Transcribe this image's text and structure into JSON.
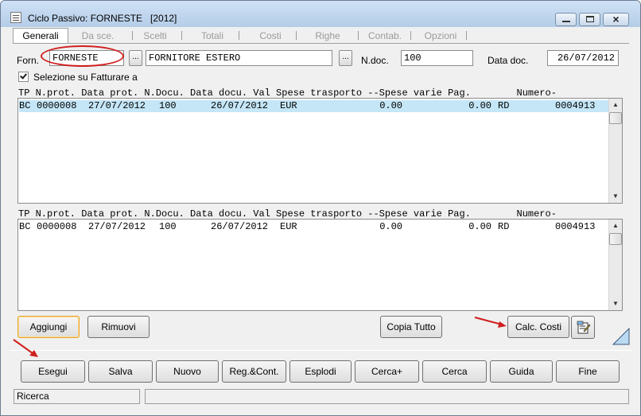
{
  "window": {
    "title": "Ciclo Passivo: FORNESTE   [2012]",
    "controls": {
      "minimize": "minimize",
      "maximize": "maximize",
      "close": "×"
    }
  },
  "tabs": [
    {
      "label": "Generali",
      "active": true
    },
    {
      "label": "Da sce.",
      "active": false
    },
    {
      "label": "Scelti",
      "active": false
    },
    {
      "label": "Totali",
      "active": false
    },
    {
      "label": "Costi",
      "active": false
    },
    {
      "label": "Righe",
      "active": false
    },
    {
      "label": "Contab.",
      "active": false
    },
    {
      "label": "Opzioni",
      "active": false
    }
  ],
  "form": {
    "forn_label": "Forn.",
    "forn_code": "FORNESTE",
    "forn_name": "FORNITORE ESTERO",
    "browse_label": "...",
    "ndoc_label": "N.doc.",
    "ndoc_value": "100",
    "datadoc_label": "Data doc.",
    "datadoc_value": "26/07/2012",
    "checkbox_label": "Selezione su Fatturare a",
    "checkbox_checked": true
  },
  "grid_top": {
    "header": "TP N.prot. Data prot. N.Docu. Data docu. Val Spese trasporto --Spese varie Pag.        Numero-",
    "rows": [
      {
        "tp": "BC",
        "nprot": "0000008",
        "data_prot": "27/07/2012",
        "ndocu": "100",
        "data_docu": "26/07/2012",
        "val": "EUR",
        "spese_trasporto": "0.00",
        "spese_varie": "0.00",
        "pag": "RD",
        "numero": "0004913",
        "selected": true
      }
    ]
  },
  "grid_bottom": {
    "header": "TP N.prot. Data prot. N.Docu. Data docu. Val Spese trasporto --Spese varie Pag.        Numero-",
    "rows": [
      {
        "tp": "BC",
        "nprot": "0000008",
        "data_prot": "27/07/2012",
        "ndocu": "100",
        "data_docu": "26/07/2012",
        "val": "EUR",
        "spese_trasporto": "0.00",
        "spese_varie": "0.00",
        "pag": "RD",
        "numero": "0004913",
        "selected": false
      }
    ]
  },
  "panel_buttons": {
    "aggiungi": "Aggiungi",
    "rimuovi": "Rimuovi",
    "copia_tutto": "Copia Tutto",
    "calc_costi": "Calc. Costi"
  },
  "bottom_buttons": {
    "esegui": "Esegui",
    "salva": "Salva",
    "nuovo": "Nuovo",
    "reg_cont": "Reg.&Cont.",
    "esplodi": "Esplodi",
    "cerca_plus": "Cerca+",
    "cerca": "Cerca",
    "guida": "Guida",
    "fine": "Fine"
  },
  "status": {
    "left": "Ricerca",
    "right": ""
  },
  "colors": {
    "title_bar": "#b9d1ea",
    "selected_row": "#c4e6f7",
    "annotation_red": "#d01f1f",
    "focus_border": "#e3a530"
  },
  "icons": {
    "title": "document-icon",
    "calc_extra": "edit-document-icon"
  }
}
